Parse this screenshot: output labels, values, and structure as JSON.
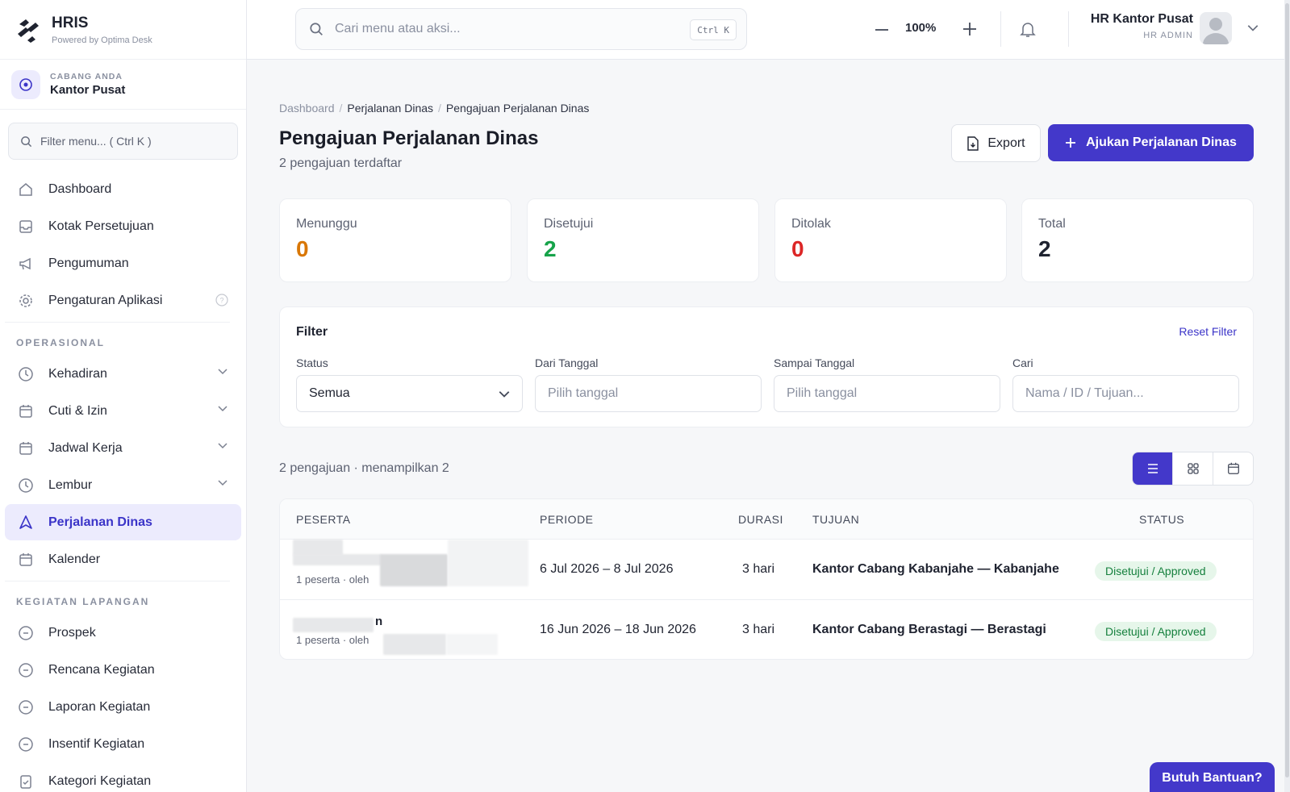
{
  "brand": {
    "title": "HRIS",
    "subtitle": "Powered by Optima Desk"
  },
  "branch": {
    "label": "CABANG ANDA",
    "name": "Kantor Pusat"
  },
  "sidebar": {
    "search_placeholder": "Filter menu... ( Ctrl K )",
    "items": [
      {
        "label": "Dashboard",
        "icon": "home-icon"
      },
      {
        "label": "Kotak Persetujuan",
        "icon": "inbox-icon"
      },
      {
        "label": "Pengumuman",
        "icon": "megaphone-icon"
      },
      {
        "label": "Pengaturan Aplikasi",
        "icon": "gear-icon"
      }
    ],
    "section_operasional": "OPERASIONAL",
    "operasional": [
      {
        "label": "Kehadiran",
        "icon": "clock-icon"
      },
      {
        "label": "Cuti & Izin",
        "icon": "calendar-icon"
      },
      {
        "label": "Jadwal Kerja",
        "icon": "calendar-icon"
      },
      {
        "label": "Lembur",
        "icon": "clock-icon"
      },
      {
        "label": "Perjalanan Dinas",
        "icon": "navigation-icon",
        "active": true
      },
      {
        "label": "Kalender",
        "icon": "calendar-icon"
      }
    ],
    "section_lapangan": "KEGIATAN LAPANGAN",
    "lapangan": [
      {
        "label": "Prospek",
        "icon": "circle-icon"
      },
      {
        "label": "Rencana Kegiatan",
        "icon": "circle-icon"
      },
      {
        "label": "Laporan Kegiatan",
        "icon": "circle-icon"
      },
      {
        "label": "Insentif Kegiatan",
        "icon": "circle-icon"
      },
      {
        "label": "Kategori Kegiatan",
        "icon": "clipboard-icon"
      }
    ]
  },
  "topbar": {
    "search_placeholder": "Cari menu atau aksi...",
    "shortcut": "Ctrl K",
    "zoom": "100%",
    "user_name": "HR Kantor Pusat",
    "user_role": "HR ADMIN"
  },
  "breadcrumb": [
    "Dashboard",
    "Perjalanan Dinas",
    "Pengajuan Perjalanan Dinas"
  ],
  "page": {
    "title": "Pengajuan Perjalanan Dinas",
    "subtitle": "2 pengajuan terdaftar",
    "export_label": "Export",
    "primary_label": "Ajukan Perjalanan Dinas"
  },
  "stats": [
    {
      "label": "Menunggu",
      "value": "0",
      "color": "#d97706"
    },
    {
      "label": "Disetujui",
      "value": "2",
      "color": "#16a34a"
    },
    {
      "label": "Ditolak",
      "value": "0",
      "color": "#dc2626"
    },
    {
      "label": "Total",
      "value": "2",
      "color": "#1f2330"
    }
  ],
  "filter": {
    "title": "Filter",
    "reset": "Reset Filter",
    "status_label": "Status",
    "status_value": "Semua",
    "from_label": "Dari Tanggal",
    "from_placeholder": "Pilih tanggal",
    "to_label": "Sampai Tanggal",
    "to_placeholder": "Pilih tanggal",
    "search_label": "Cari",
    "search_placeholder": "Nama / ID / Tujuan..."
  },
  "list": {
    "count_text": "2 pengajuan · menampilkan 2"
  },
  "table": {
    "headers": {
      "peserta": "PESERTA",
      "periode": "PERIODE",
      "durasi": "DURASI",
      "tujuan": "TUJUAN",
      "status": "STATUS"
    },
    "rows": [
      {
        "meta": "1 peserta · oleh",
        "periode": "6 Jul 2026 – 8 Jul 2026",
        "durasi": "3 hari",
        "tujuan": "Kantor Cabang Kabanjahe — Kabanjahe",
        "status": "Disetujui / Approved"
      },
      {
        "name_tail": "n",
        "meta": "1 peserta · oleh",
        "periode": "16 Jun 2026 – 18 Jun 2026",
        "durasi": "3 hari",
        "tujuan": "Kantor Cabang Berastagi — Berastagi",
        "status": "Disetujui / Approved"
      }
    ]
  },
  "help_label": "Butuh Bantuan?",
  "colors": {
    "accent": "#4338ca",
    "active_bg": "#ecebfd",
    "approved_bg": "#e6f6ea",
    "approved_text": "#15803d"
  }
}
